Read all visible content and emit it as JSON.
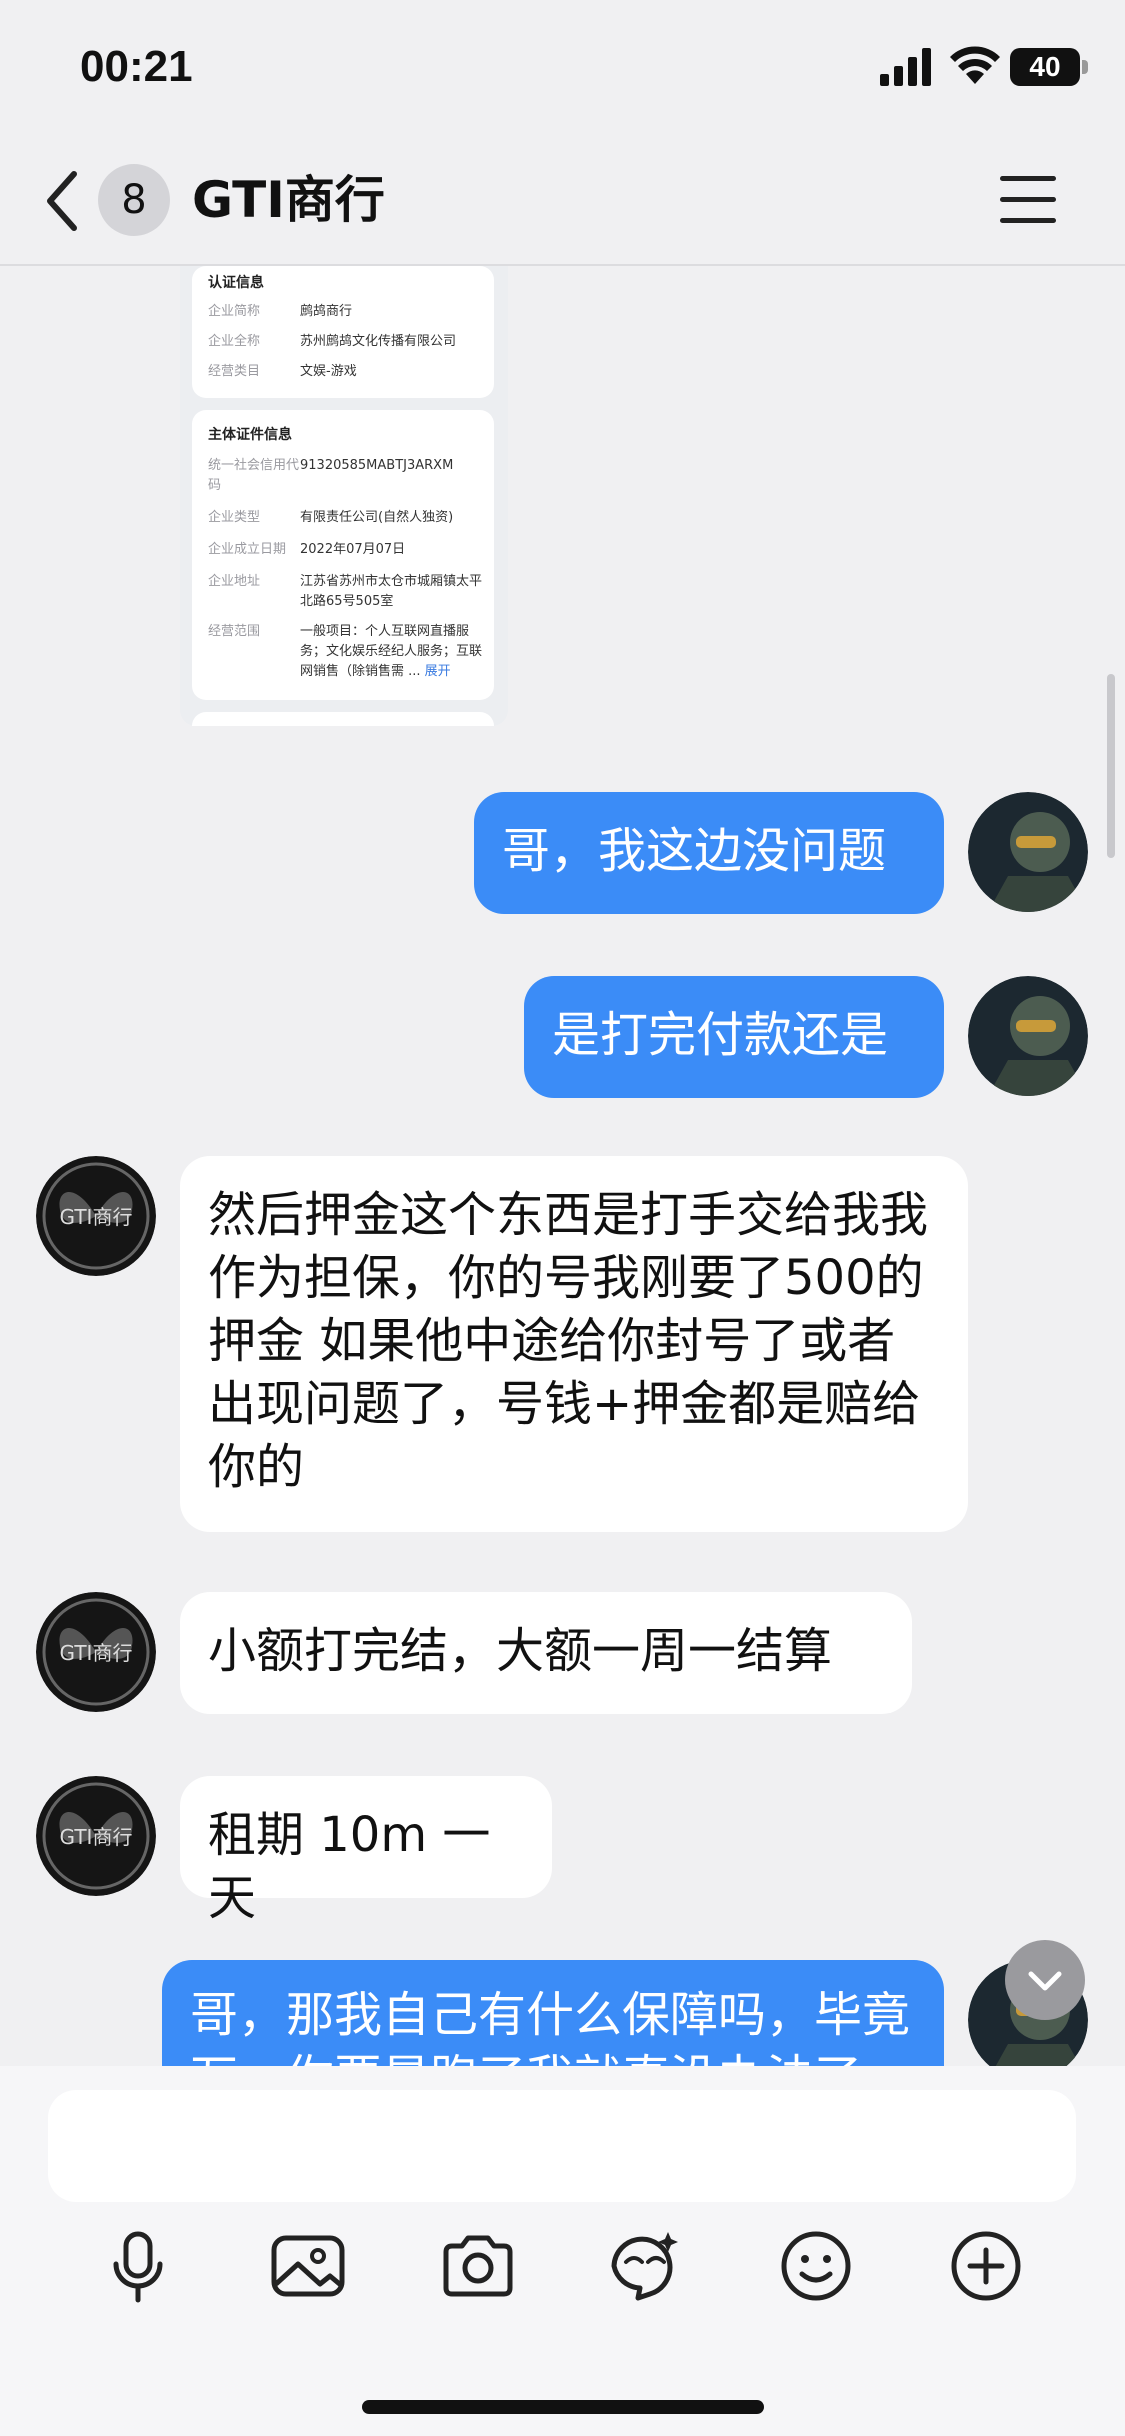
{
  "status_bar": {
    "time": "00:21",
    "battery": "40"
  },
  "nav": {
    "unread_count": "8",
    "title": "GTI商行"
  },
  "card": {
    "section1_title": "认证信息",
    "section1_rows": [
      {
        "key": "企业简称",
        "value": "鹧鸪商行"
      },
      {
        "key": "企业全称",
        "value": "苏州鹧鸪文化传播有限公司"
      },
      {
        "key": "经营类目",
        "value": "文娱-游戏"
      }
    ],
    "section2_title": "主体证件信息",
    "section2_rows": [
      {
        "key": "统一社会信用代码",
        "value": "91320585MABTJ3ARXM"
      },
      {
        "key": "企业类型",
        "value": "有限责任公司(自然人独资)"
      },
      {
        "key": "企业成立日期",
        "value": "2022年07月07日"
      },
      {
        "key": "企业地址",
        "value": "江苏省苏州市太仓市城厢镇太平北路65号505室"
      },
      {
        "key": "经营范围",
        "value": "一般项目：个人互联网直播服务；文化娱乐经纪人服务；互联网销售（除销售需 ...",
        "more": "展开"
      }
    ]
  },
  "messages": [
    {
      "from": "me",
      "text": "哥，我这边没问题"
    },
    {
      "from": "me",
      "text": "是打完付款还是"
    },
    {
      "from": "them",
      "text": "然后押金这个东西是打手交给我我作为担保，你的号我刚要了500的押金 如果他中途给你封号了或者出现问题了，号钱+押金都是赔给你的"
    },
    {
      "from": "them",
      "text": "小额打完结，大额一周一结算"
    },
    {
      "from": "them",
      "text": "租期 10m 一天"
    },
    {
      "from": "me",
      "text": "哥，那我自己有什么保障吗，毕竟万一你要是跑了我就真没办法了"
    }
  ],
  "avatar_label": "GTI商行",
  "toolbar_icons": [
    "microphone-icon",
    "image-icon",
    "camera-icon",
    "sticker-icon",
    "emoji-icon",
    "plus-icon"
  ],
  "colors": {
    "accent": "#3b8cf7",
    "background": "#f0f0f2"
  }
}
